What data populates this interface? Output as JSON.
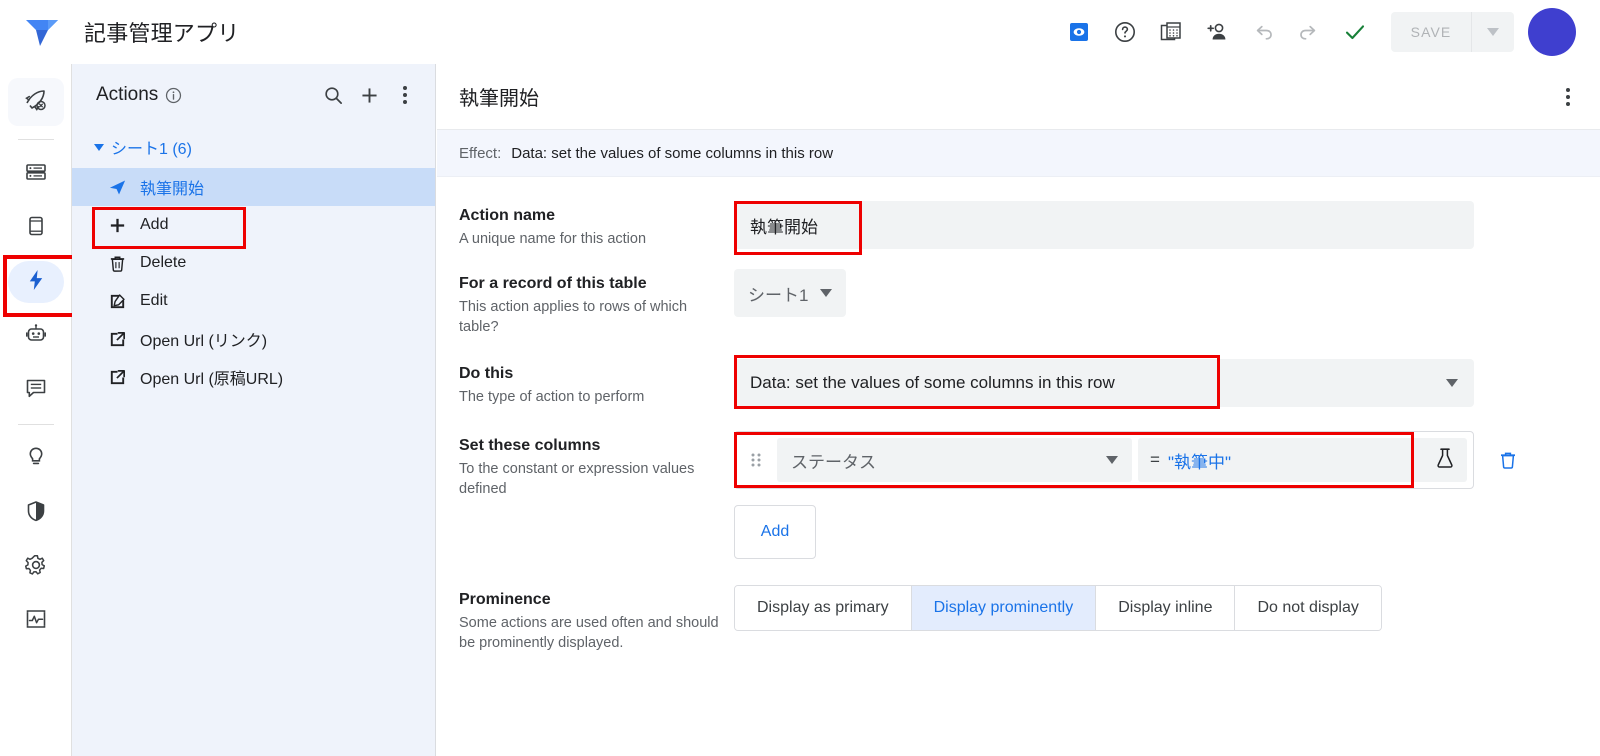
{
  "topbar": {
    "app_title": "記事管理アプリ",
    "logo_icon": "appsheet-logo-icon",
    "icons": [
      {
        "name": "preview-app-icon",
        "glyph": "eye-in-box"
      },
      {
        "name": "help-icon",
        "glyph": "question-circle"
      },
      {
        "name": "data-source-icon",
        "glyph": "spreadsheet-stack"
      },
      {
        "name": "add-user-icon",
        "glyph": "person-plus"
      },
      {
        "name": "undo-icon",
        "glyph": "undo-arrow"
      },
      {
        "name": "redo-icon",
        "glyph": "redo-arrow"
      },
      {
        "name": "validation-ok-icon",
        "glyph": "check"
      }
    ],
    "save_label": "SAVE",
    "save_enabled": false,
    "avatar_color": "#3f3fcf"
  },
  "rail": {
    "items": [
      {
        "name": "rail-item-deploy",
        "icon": "rocket-icon",
        "active": false,
        "pill": true
      },
      {
        "name": "rail-item-data",
        "icon": "database-icon",
        "active": false
      },
      {
        "name": "rail-item-app",
        "icon": "phone-icon",
        "active": false
      },
      {
        "name": "rail-item-actions",
        "icon": "lightning-bolt-icon",
        "active": true,
        "highlight": true
      },
      {
        "name": "rail-item-automation",
        "icon": "robot-icon",
        "active": false
      },
      {
        "name": "rail-item-chat",
        "icon": "chat-icon",
        "active": false
      },
      {
        "name": "rail-item-intelligence",
        "icon": "lightbulb-icon",
        "active": false
      },
      {
        "name": "rail-item-security",
        "icon": "shield-icon",
        "active": false
      },
      {
        "name": "rail-item-settings",
        "icon": "gear-icon",
        "active": false
      },
      {
        "name": "rail-item-monitor",
        "icon": "activity-chart-icon",
        "active": false
      }
    ]
  },
  "sidebar": {
    "title": "Actions",
    "info_icon": "info-circle-icon",
    "search_icon": "search-icon",
    "add_icon": "plus-icon",
    "more_icon": "kebab-menu-icon",
    "group": {
      "label": "シート1 (6)",
      "expanded": true
    },
    "items": [
      {
        "label": "執筆開始",
        "icon": "paper-plane-icon",
        "selected": true,
        "highlight": false
      },
      {
        "label": "Add",
        "icon": "plus-icon",
        "selected": false,
        "highlight": true
      },
      {
        "label": "Delete",
        "icon": "trash-icon",
        "selected": false,
        "highlight": false
      },
      {
        "label": "Edit",
        "icon": "pencil-square-icon",
        "selected": false,
        "highlight": false
      },
      {
        "label": "Open Url (リンク)",
        "icon": "external-link-icon",
        "selected": false,
        "highlight": false
      },
      {
        "label": "Open Url (原稿URL)",
        "icon": "external-link-icon",
        "selected": false,
        "highlight": false
      }
    ]
  },
  "main": {
    "pane_title": "執筆開始",
    "pane_more_icon": "kebab-menu-icon",
    "effect_label": "Effect:",
    "effect_value": "Data: set the values of some columns in this row",
    "fields": {
      "action_name": {
        "title": "Action name",
        "desc": "A unique name for this action",
        "value": "執筆開始",
        "highlight": true
      },
      "table": {
        "title": "For a record of this table",
        "desc": "This action applies to rows of which table?",
        "value": "シート1"
      },
      "do_this": {
        "title": "Do this",
        "desc": "The type of action to perform",
        "value": "Data: set the values of some columns in this row",
        "highlight": true
      },
      "set_columns": {
        "title": "Set these columns",
        "desc": "To the constant or expression values defined",
        "highlight": true,
        "rows": [
          {
            "drag_icon": "drag-handle-icon",
            "column": "ステータス",
            "equals": "=",
            "expression": "\"執筆中\"",
            "flask_icon": "flask-icon",
            "delete_icon": "trash-icon"
          }
        ],
        "add_label": "Add"
      },
      "prominence": {
        "title": "Prominence",
        "desc": "Some actions are used often and should be prominently displayed.",
        "options": [
          {
            "label": "Display as primary",
            "selected": false
          },
          {
            "label": "Display prominently",
            "selected": true
          },
          {
            "label": "Display inline",
            "selected": false
          },
          {
            "label": "Do not display",
            "selected": false
          }
        ]
      }
    }
  },
  "colors": {
    "accent_blue": "#1a73e8",
    "highlight_red": "#ee0000",
    "sidebar_bg": "#eff3fb",
    "selected_row": "#c8dcf8",
    "field_bg": "#f1f3f4"
  }
}
